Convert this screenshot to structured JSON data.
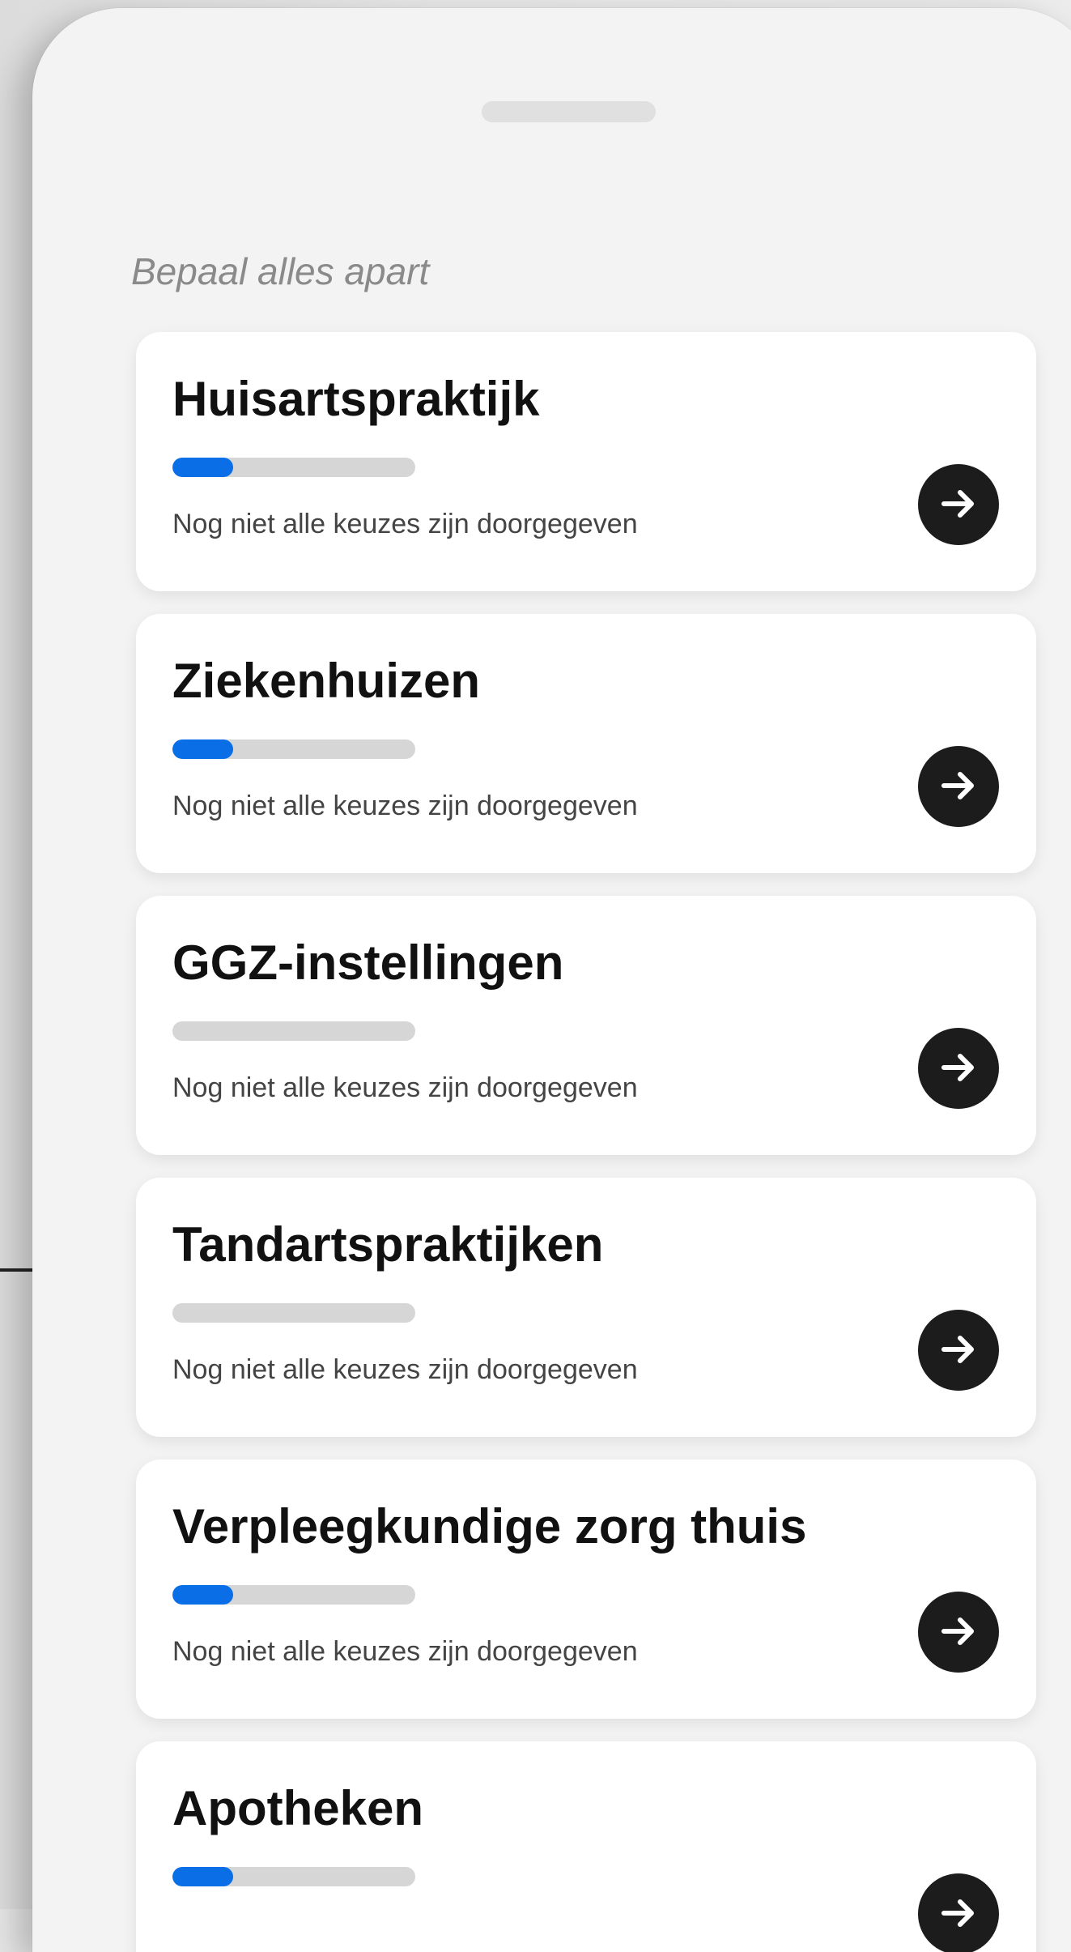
{
  "section": {
    "title": "Bepaal alles apart"
  },
  "cards": [
    {
      "title": "Huisartspraktijk",
      "status": "Nog niet alle keuzes zijn doorgegeven",
      "progress": 0.25
    },
    {
      "title": "Ziekenhuizen",
      "status": "Nog niet alle keuzes zijn doorgegeven",
      "progress": 0.25
    },
    {
      "title": "GGZ-instellingen",
      "status": "Nog niet alle keuzes zijn doorgegeven",
      "progress": 0
    },
    {
      "title": "Tandartspraktijken",
      "status": "Nog niet alle keuzes zijn doorgegeven",
      "progress": 0
    },
    {
      "title": "Verpleegkundige zorg thuis",
      "status": "Nog niet alle keuzes zijn doorgegeven",
      "progress": 0.25
    },
    {
      "title": "Apotheken",
      "status": "",
      "progress": 0.25
    }
  ],
  "colors": {
    "progress_fill": "#0a6fe6",
    "progress_track": "#d6d6d6",
    "arrow_button": "#1c1c1c"
  },
  "icons": {
    "card_action": "arrow-right-icon"
  }
}
